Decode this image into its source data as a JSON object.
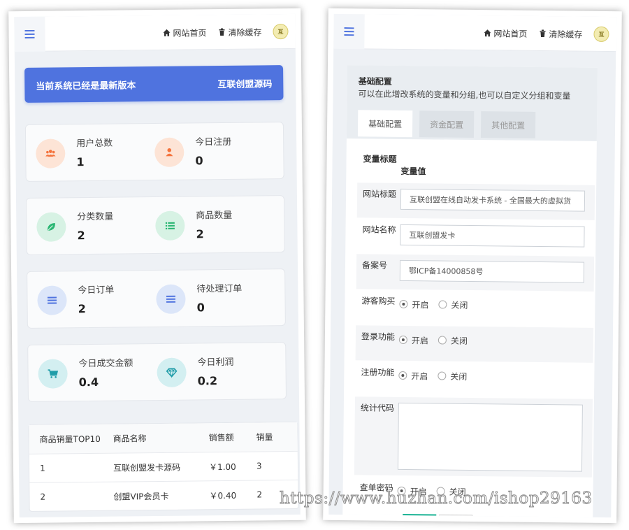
{
  "topbar": {
    "home_label": "网站首页",
    "clear_cache_label": "清除缓存"
  },
  "dashboard": {
    "banner_left": "当前系统已经是最新版本",
    "banner_right": "互联创盟源码",
    "stats": [
      {
        "label": "用户总数",
        "value": "1",
        "icon": "users-icon",
        "color": "#f4733c",
        "bg": "#fde4d6"
      },
      {
        "label": "今日注册",
        "value": "0",
        "icon": "user-icon",
        "color": "#f4733c",
        "bg": "#fde4d6"
      },
      {
        "label": "分类数量",
        "value": "2",
        "icon": "leaf-icon",
        "color": "#2bb673",
        "bg": "#d7f2e4"
      },
      {
        "label": "商品数量",
        "value": "2",
        "icon": "list-icon",
        "color": "#2bb673",
        "bg": "#d7f2e4"
      },
      {
        "label": "今日订单",
        "value": "2",
        "icon": "bars-icon",
        "color": "#4f73df",
        "bg": "#dce6f9"
      },
      {
        "label": "待处理订单",
        "value": "0",
        "icon": "bars-icon",
        "color": "#4f73df",
        "bg": "#dce6f9"
      },
      {
        "label": "今日成交金额",
        "value": "0.4",
        "icon": "cart-icon",
        "color": "#1f9ca8",
        "bg": "#d3eff1"
      },
      {
        "label": "今日利润",
        "value": "0.2",
        "icon": "diamond-icon",
        "color": "#1f9ca8",
        "bg": "#d3eff1"
      }
    ],
    "table": {
      "headers": [
        "商品销量TOP10",
        "商品名称",
        "销售额",
        "销量"
      ],
      "rows": [
        [
          "1",
          "互联创盟发卡源码",
          "￥1.00",
          "3"
        ],
        [
          "2",
          "创盟VIP会员卡",
          "￥0.40",
          "2"
        ]
      ]
    }
  },
  "config": {
    "title": "基础配置",
    "subtitle": "可以在此增改系统的变量和分组,也可以自定义分组和变量",
    "tabs": [
      "基础配置",
      "资金配置",
      "其他配置"
    ],
    "col_title": "变量标题",
    "col_value": "变量值",
    "site_title_label": "网站标题",
    "site_title_value": "互联创盟在线自动发卡系统 - 全国最大的虚拟货",
    "site_name_label": "网站名称",
    "site_name_value": "互联创盟发卡",
    "icp_label": "备案号",
    "icp_value": "鄂ICP备14000858号",
    "guest_label": "游客购买",
    "login_label": "登录功能",
    "register_label": "注册功能",
    "stats_code_label": "统计代码",
    "query_pwd_label": "查单密码",
    "on_label": "开启",
    "off_label": "关闭"
  },
  "watermark": "https://www.huzhan.com/ishop29163"
}
